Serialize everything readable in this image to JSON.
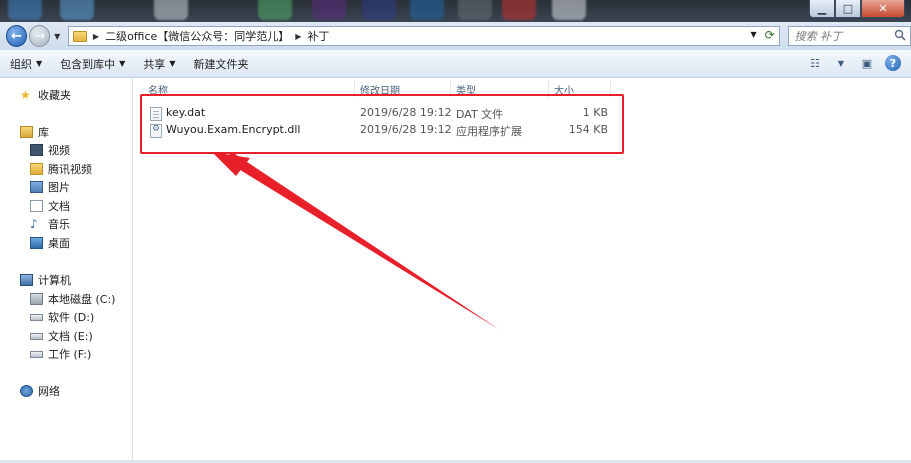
{
  "window": {
    "controls": {
      "minimize": "▁",
      "maximize": "□",
      "close": "✕"
    }
  },
  "address": {
    "crumbs": [
      "二级office【微信公众号：同学范儿】",
      "补丁"
    ],
    "search_placeholder": "搜索 补丁"
  },
  "toolbar": {
    "organize": "组织",
    "include_library": "包含到库中",
    "share": "共享",
    "new_folder": "新建文件夹"
  },
  "sidebar": {
    "favorites": "收藏夹",
    "libraries": "库",
    "library_items": [
      "视频",
      "腾讯视频",
      "图片",
      "文档",
      "音乐",
      "桌面"
    ],
    "computer": "计算机",
    "drives": [
      "本地磁盘 (C:)",
      "软件 (D:)",
      "文档 (E:)",
      "工作 (F:)"
    ],
    "network": "网络"
  },
  "columns": {
    "name": "名称",
    "modified": "修改日期",
    "type": "类型",
    "size": "大小"
  },
  "files": [
    {
      "name": "key.dat",
      "modified": "2019/6/28 19:12",
      "type": "DAT 文件",
      "size": "1 KB",
      "icon": "dat-file-icon"
    },
    {
      "name": "Wuyou.Exam.Encrypt.dll",
      "modified": "2019/6/28 19:12",
      "type": "应用程序扩展",
      "size": "154 KB",
      "icon": "dll-file-icon"
    }
  ],
  "colors": {
    "annotation": "#e8202a",
    "accent": "#1f5fb3"
  }
}
